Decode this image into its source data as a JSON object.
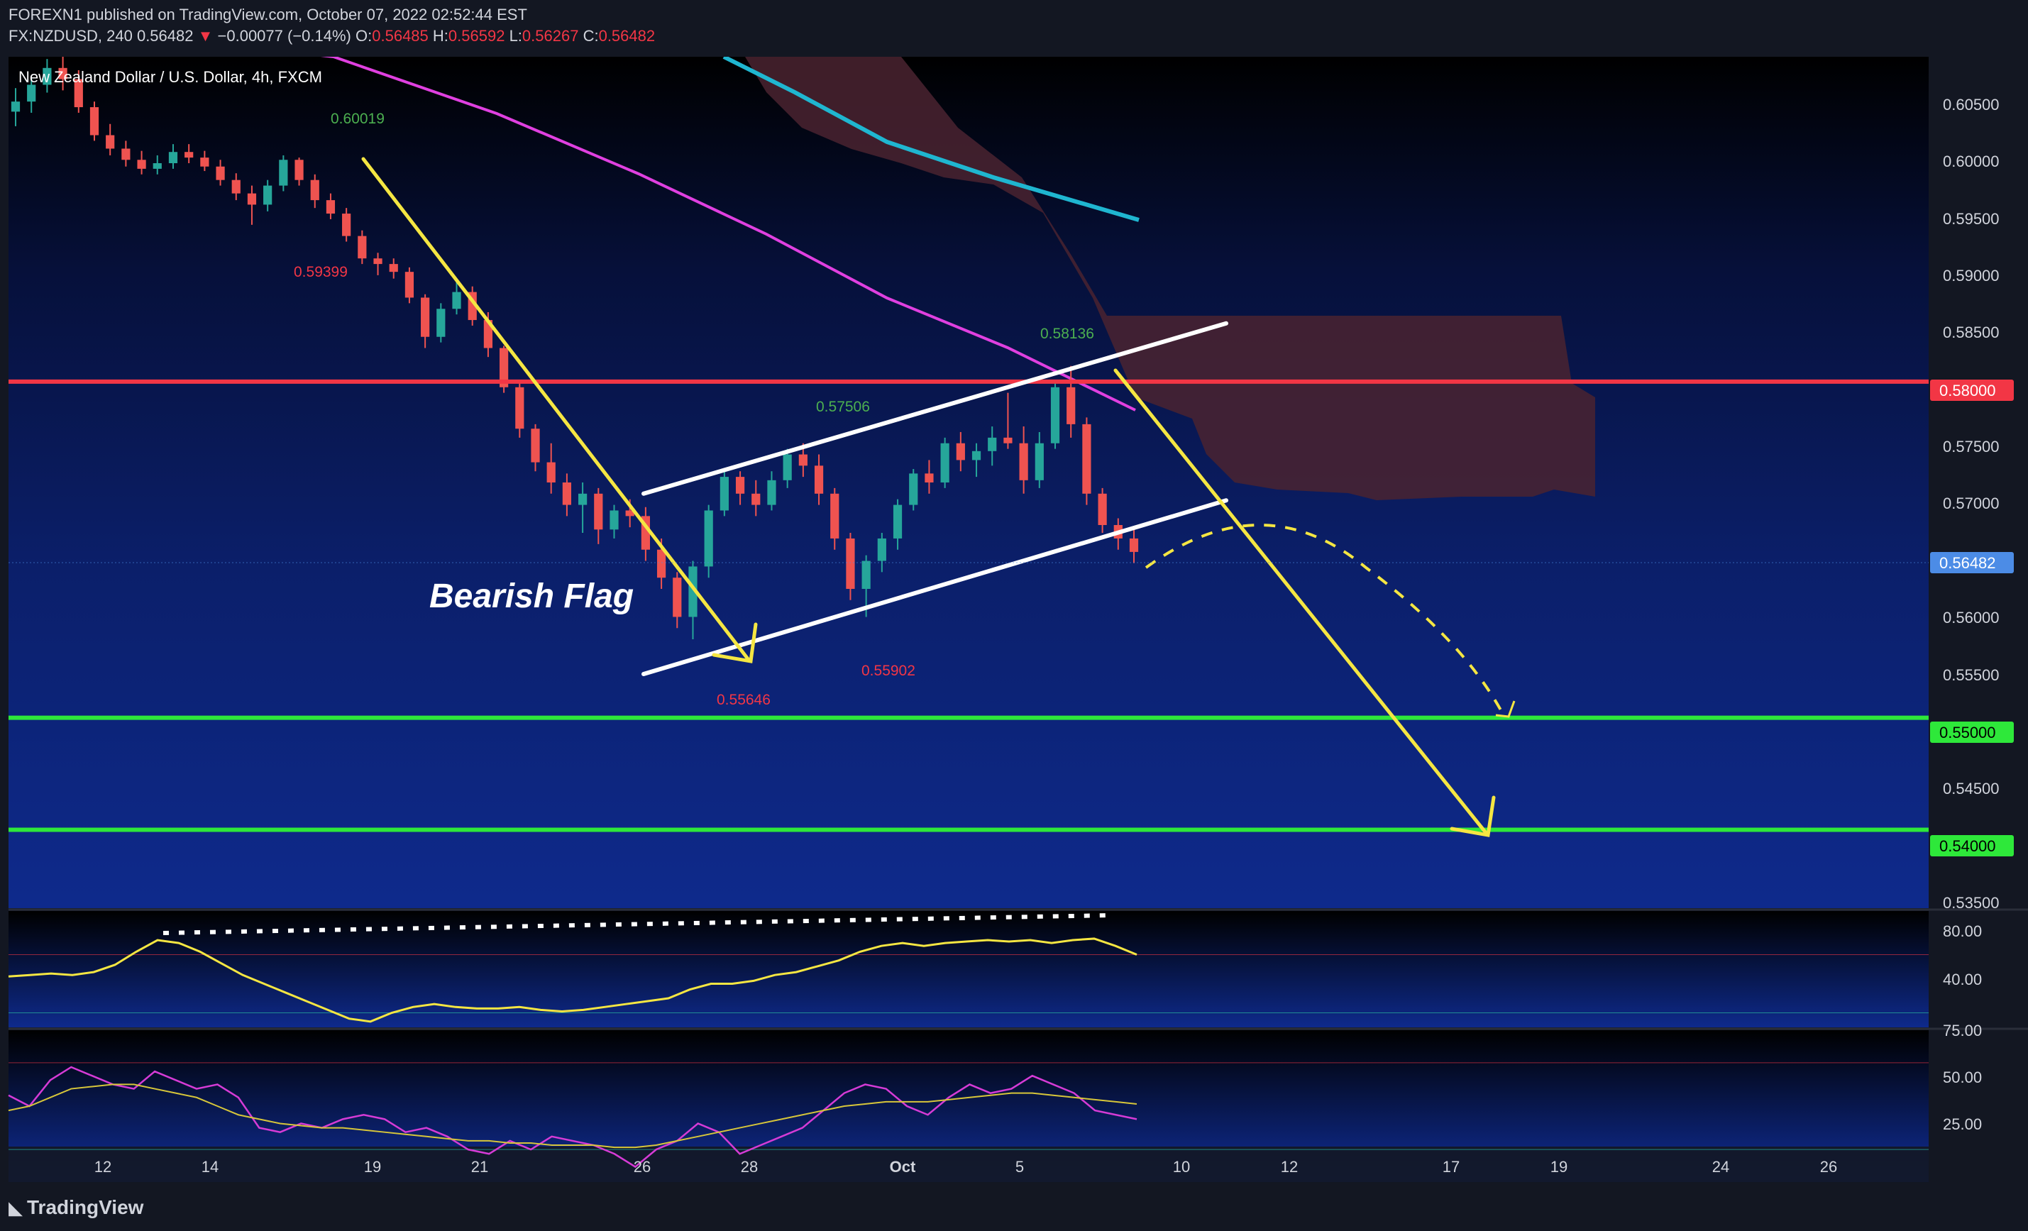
{
  "header": {
    "line1": "FOREXN1 published on TradingView.com, October 07, 2022 02:52:44 EST",
    "symbol": "FX:NZDUSD, 240",
    "last": "0.56482",
    "change_arrow": "▼",
    "change": "−0.00077 (−0.14%)",
    "o_label": "O:",
    "o_value": "0.56485",
    "h_label": "H:",
    "h_value": "0.56592",
    "l_label": "L:",
    "l_value": "0.56267",
    "c_label": "C:",
    "c_value": "0.56482"
  },
  "chart_title": "New Zealand Dollar / U.S. Dollar, 4h, FXCM",
  "pattern_label": "Bearish Flag",
  "price_annotations": [
    {
      "text": "0.60019",
      "kind": "high"
    },
    {
      "text": "0.59399",
      "kind": "low"
    },
    {
      "text": "0.58136",
      "kind": "high"
    },
    {
      "text": "0.57506",
      "kind": "high"
    },
    {
      "text": "0.55902",
      "kind": "low"
    },
    {
      "text": "0.55646",
      "kind": "low"
    }
  ],
  "price_axis": {
    "ticks": [
      "0.60500",
      "0.60000",
      "0.59500",
      "0.59000",
      "0.58500",
      "0.57500",
      "0.57000",
      "0.56000",
      "0.55500",
      "0.54500",
      "0.53500"
    ],
    "labels": [
      {
        "text": "0.58000",
        "color": "#f23645"
      },
      {
        "text": "0.56482",
        "color": "#4c8ce6"
      },
      {
        "text": "0.55000",
        "color": "#2ee83a"
      },
      {
        "text": "0.54000",
        "color": "#2ee83a"
      }
    ]
  },
  "osc1_axis": [
    "80.00",
    "40.00"
  ],
  "osc2_axis": [
    "75.00",
    "50.00",
    "25.00"
  ],
  "time_axis": [
    "12",
    "14",
    "19",
    "21",
    "26",
    "28",
    "Oct",
    "5",
    "10",
    "12",
    "17",
    "19",
    "24",
    "26"
  ],
  "footer": {
    "logo_text": "TradingView"
  },
  "colors": {
    "background": "#0d1d5e",
    "resistance": "#f23645",
    "support": "#2ee83a",
    "ema_magenta": "#e040e0",
    "ema_cyan": "#1fb6d0",
    "cloud": "#4a2330",
    "annotation_yellow": "#f5e642",
    "channel_white": "#ffffff",
    "bull": "#26a69a",
    "bear": "#ef5350"
  },
  "chart_data": {
    "type": "candlestick",
    "symbol": "FX:NZDUSD",
    "timeframe": "4h",
    "ylim": [
      0.533,
      0.609
    ],
    "candles_ohlc": [
      [
        0.6041,
        0.6062,
        0.6028,
        0.605
      ],
      [
        0.605,
        0.6071,
        0.604,
        0.6065
      ],
      [
        0.6065,
        0.6088,
        0.6058,
        0.608
      ],
      [
        0.608,
        0.609,
        0.606,
        0.607
      ],
      [
        0.607,
        0.6078,
        0.604,
        0.6045
      ],
      [
        0.6045,
        0.605,
        0.6015,
        0.602
      ],
      [
        0.602,
        0.603,
        0.6002,
        0.6008
      ],
      [
        0.6008,
        0.6015,
        0.5992,
        0.5998
      ],
      [
        0.5998,
        0.6006,
        0.5985,
        0.599
      ],
      [
        0.599,
        0.6002,
        0.5985,
        0.5995
      ],
      [
        0.5995,
        0.6012,
        0.599,
        0.6005
      ],
      [
        0.6005,
        0.6012,
        0.5995,
        0.6
      ],
      [
        0.6,
        0.6006,
        0.5988,
        0.5992
      ],
      [
        0.5992,
        0.5998,
        0.5975,
        0.598
      ],
      [
        0.598,
        0.5986,
        0.5962,
        0.5968
      ],
      [
        0.5968,
        0.5975,
        0.594,
        0.5958
      ],
      [
        0.5958,
        0.598,
        0.5952,
        0.5975
      ],
      [
        0.5975,
        0.6002,
        0.597,
        0.5998
      ],
      [
        0.5998,
        0.6,
        0.5975,
        0.598
      ],
      [
        0.598,
        0.5985,
        0.5955,
        0.5962
      ],
      [
        0.5962,
        0.5968,
        0.5945,
        0.595
      ],
      [
        0.595,
        0.5955,
        0.5925,
        0.593
      ],
      [
        0.593,
        0.5935,
        0.5905,
        0.591
      ],
      [
        0.591,
        0.5915,
        0.5895,
        0.5905
      ],
      [
        0.5905,
        0.591,
        0.5892,
        0.5898
      ],
      [
        0.5898,
        0.5902,
        0.587,
        0.5875
      ],
      [
        0.5875,
        0.5878,
        0.583,
        0.584
      ],
      [
        0.584,
        0.587,
        0.5835,
        0.5865
      ],
      [
        0.5865,
        0.589,
        0.586,
        0.588
      ],
      [
        0.588,
        0.5885,
        0.585,
        0.5855
      ],
      [
        0.5855,
        0.5862,
        0.5822,
        0.583
      ],
      [
        0.583,
        0.5832,
        0.579,
        0.5795
      ],
      [
        0.5795,
        0.58,
        0.575,
        0.5758
      ],
      [
        0.5758,
        0.5762,
        0.572,
        0.5728
      ],
      [
        0.5728,
        0.5745,
        0.57,
        0.571
      ],
      [
        0.571,
        0.5718,
        0.568,
        0.569
      ],
      [
        0.569,
        0.571,
        0.5665,
        0.57
      ],
      [
        0.57,
        0.5705,
        0.5655,
        0.5668
      ],
      [
        0.5668,
        0.569,
        0.566,
        0.5685
      ],
      [
        0.5685,
        0.5695,
        0.567,
        0.568
      ],
      [
        0.568,
        0.5688,
        0.564,
        0.565
      ],
      [
        0.565,
        0.566,
        0.5615,
        0.5625
      ],
      [
        0.5625,
        0.563,
        0.558,
        0.559
      ],
      [
        0.559,
        0.564,
        0.557,
        0.5635
      ],
      [
        0.5635,
        0.569,
        0.5625,
        0.5685
      ],
      [
        0.5685,
        0.5722,
        0.568,
        0.5715
      ],
      [
        0.5715,
        0.572,
        0.569,
        0.57
      ],
      [
        0.57,
        0.5712,
        0.568,
        0.569
      ],
      [
        0.569,
        0.572,
        0.5685,
        0.5712
      ],
      [
        0.5712,
        0.574,
        0.5705,
        0.5735
      ],
      [
        0.5735,
        0.5745,
        0.5715,
        0.5725
      ],
      [
        0.5725,
        0.5735,
        0.569,
        0.57
      ],
      [
        0.57,
        0.5705,
        0.565,
        0.566
      ],
      [
        0.566,
        0.5665,
        0.5605,
        0.5615
      ],
      [
        0.5615,
        0.5645,
        0.559,
        0.564
      ],
      [
        0.564,
        0.5665,
        0.563,
        0.566
      ],
      [
        0.566,
        0.5695,
        0.565,
        0.569
      ],
      [
        0.569,
        0.5722,
        0.5685,
        0.5718
      ],
      [
        0.5718,
        0.573,
        0.57,
        0.571
      ],
      [
        0.571,
        0.575,
        0.5705,
        0.5745
      ],
      [
        0.5745,
        0.5755,
        0.572,
        0.573
      ],
      [
        0.573,
        0.5745,
        0.5715,
        0.5738
      ],
      [
        0.5738,
        0.576,
        0.5725,
        0.575
      ],
      [
        0.575,
        0.579,
        0.574,
        0.5745
      ],
      [
        0.5745,
        0.576,
        0.57,
        0.5712
      ],
      [
        0.5712,
        0.5755,
        0.5705,
        0.5745
      ],
      [
        0.5745,
        0.58,
        0.574,
        0.5795
      ],
      [
        0.5795,
        0.5814,
        0.575,
        0.5762
      ],
      [
        0.5762,
        0.5768,
        0.569,
        0.57
      ],
      [
        0.57,
        0.5705,
        0.5665,
        0.5672
      ],
      [
        0.5672,
        0.5678,
        0.565,
        0.566
      ],
      [
        0.566,
        0.5668,
        0.5638,
        0.5648
      ]
    ],
    "horizontal_levels": [
      {
        "price": 0.58,
        "role": "resistance"
      },
      {
        "price": 0.55,
        "role": "support"
      },
      {
        "price": 0.54,
        "role": "support"
      }
    ],
    "channel": {
      "upper": [
        [
          0.57,
          0
        ],
        [
          0.5852,
          1
        ]
      ],
      "lower": [
        [
          0.5539,
          0
        ],
        [
          0.5694,
          1
        ]
      ]
    },
    "oscillator_1": {
      "ylim": [
        20,
        100
      ],
      "levels": [
        70,
        30
      ],
      "series": [
        55,
        56,
        57,
        56,
        58,
        63,
        72,
        80,
        78,
        72,
        64,
        56,
        50,
        44,
        38,
        32,
        26,
        24,
        30,
        34,
        36,
        34,
        33,
        33,
        34,
        32,
        31,
        32,
        34,
        36,
        38,
        40,
        46,
        50,
        50,
        52,
        56,
        58,
        62,
        66,
        72,
        76,
        78,
        76,
        78,
        79,
        80,
        79,
        80,
        78,
        80,
        81,
        76,
        70
      ]
    },
    "oscillator_2": {
      "ylim": [
        15,
        85
      ],
      "levels": [
        70,
        30
      ],
      "rsi": [
        55,
        50,
        62,
        68,
        64,
        60,
        58,
        66,
        62,
        58,
        60,
        54,
        40,
        38,
        42,
        40,
        44,
        46,
        44,
        38,
        40,
        36,
        30,
        28,
        34,
        30,
        36,
        34,
        32,
        28,
        22,
        30,
        34,
        42,
        38,
        28,
        32,
        36,
        40,
        48,
        56,
        60,
        58,
        50,
        46,
        54,
        60,
        56,
        58,
        64,
        60,
        56,
        48,
        46,
        44
      ],
      "ma": [
        48,
        50,
        54,
        58,
        59,
        60,
        60,
        58,
        56,
        54,
        50,
        46,
        44,
        42,
        41,
        40,
        40,
        39,
        38,
        37,
        36,
        35,
        34,
        34,
        33,
        33,
        32,
        32,
        32,
        31,
        31,
        32,
        34,
        36,
        38,
        40,
        42,
        44,
        46,
        48,
        50,
        51,
        52,
        52,
        52,
        53,
        54,
        55,
        56,
        56,
        55,
        54,
        53,
        52,
        51
      ]
    }
  }
}
